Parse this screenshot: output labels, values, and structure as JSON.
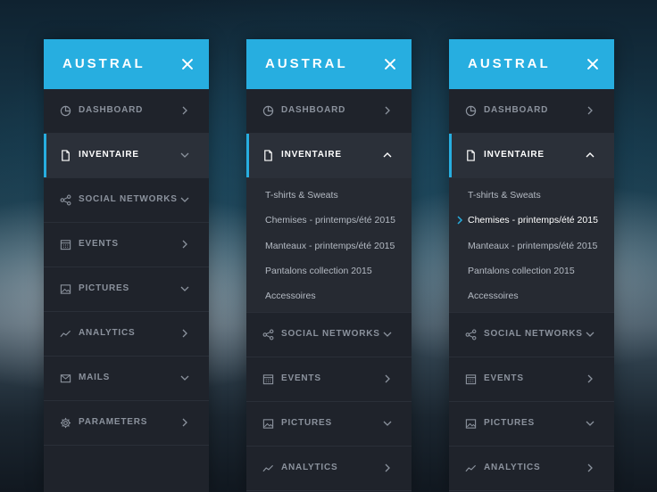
{
  "brand": {
    "name": "AUSTRAL"
  },
  "colors": {
    "accent": "#27aee0",
    "panel_bg": "#1f232b",
    "active_bg": "#2b3039",
    "label": "#8b929d"
  },
  "panels": [
    {
      "items": [
        {
          "label": "DASHBOARD",
          "icon": "dashboard-icon"
        },
        {
          "label": "INVENTAIRE",
          "icon": "document-icon",
          "active": true
        },
        {
          "label": "SOCIAL NETWORKS",
          "icon": "share-icon"
        },
        {
          "label": "EVENTS",
          "icon": "calendar-icon"
        },
        {
          "label": "PICTURES",
          "icon": "image-icon"
        },
        {
          "label": "ANALYTICS",
          "icon": "analytics-icon"
        },
        {
          "label": "MAILS",
          "icon": "mail-icon"
        },
        {
          "label": "PARAMETERS",
          "icon": "gear-icon"
        }
      ]
    },
    {
      "items": [
        {
          "label": "DASHBOARD",
          "icon": "dashboard-icon"
        },
        {
          "label": "INVENTAIRE",
          "icon": "document-icon",
          "active": true,
          "expanded": true
        },
        {
          "label": "SOCIAL NETWORKS",
          "icon": "share-icon"
        },
        {
          "label": "EVENTS",
          "icon": "calendar-icon"
        },
        {
          "label": "PICTURES",
          "icon": "image-icon"
        },
        {
          "label": "ANALYTICS",
          "icon": "analytics-icon"
        }
      ],
      "submenu": [
        "T-shirts & Sweats",
        "Chemises - printemps/été 2015",
        "Manteaux - printemps/été 2015",
        "Pantalons collection 2015",
        "Accessoires"
      ]
    },
    {
      "items": [
        {
          "label": "DASHBOARD",
          "icon": "dashboard-icon"
        },
        {
          "label": "INVENTAIRE",
          "icon": "document-icon",
          "active": true,
          "expanded": true
        },
        {
          "label": "SOCIAL NETWORKS",
          "icon": "share-icon"
        },
        {
          "label": "EVENTS",
          "icon": "calendar-icon"
        },
        {
          "label": "PICTURES",
          "icon": "image-icon"
        },
        {
          "label": "ANALYTICS",
          "icon": "analytics-icon"
        }
      ],
      "submenu": [
        "T-shirts & Sweats",
        "Chemises - printemps/été 2015",
        "Manteaux - printemps/été 2015",
        "Pantalons collection 2015",
        "Accessoires"
      ],
      "submenu_selected": 1
    }
  ]
}
